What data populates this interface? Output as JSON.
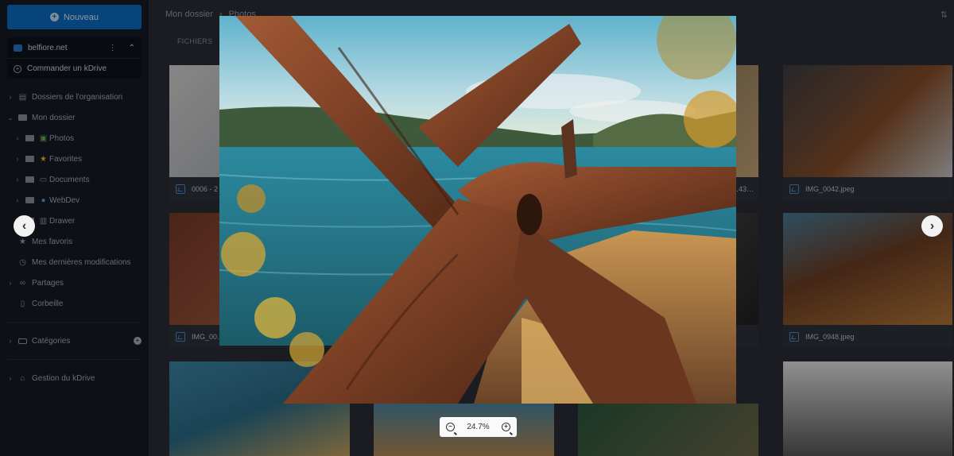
{
  "sidebar": {
    "new_button": "Nouveau",
    "drive_name": "belfiore.net",
    "order_kdrive": "Commander un kDrive",
    "items": [
      {
        "label": "Dossiers de l'organisation"
      },
      {
        "label": "Mon dossier"
      },
      {
        "label": "Photos"
      },
      {
        "label": "Favorites"
      },
      {
        "label": "Documents"
      },
      {
        "label": "WebDev"
      },
      {
        "label": "Drawer"
      },
      {
        "label": "Mes favoris"
      },
      {
        "label": "Mes dernières modifications"
      },
      {
        "label": "Partages"
      },
      {
        "label": "Corbeille"
      },
      {
        "label": "Catégories"
      },
      {
        "label": "Gestion du kDrive"
      }
    ]
  },
  "header": {
    "breadcrumb_root": "Mon dossier",
    "breadcrumb_current": "Photos",
    "tab_files": "FICHIERS"
  },
  "files": [
    {
      "name": "0006 - 2"
    },
    {
      "name": "…43…"
    },
    {
      "name": "IMG_0042.jpeg"
    },
    {
      "name": "IMG_00…"
    },
    {
      "name": "IMG_0948.jpeg"
    }
  ],
  "viewer": {
    "zoom_level": "24.7%"
  },
  "colors": {
    "accent": "#0b6fc7",
    "sidebar_bg": "#151a24"
  }
}
